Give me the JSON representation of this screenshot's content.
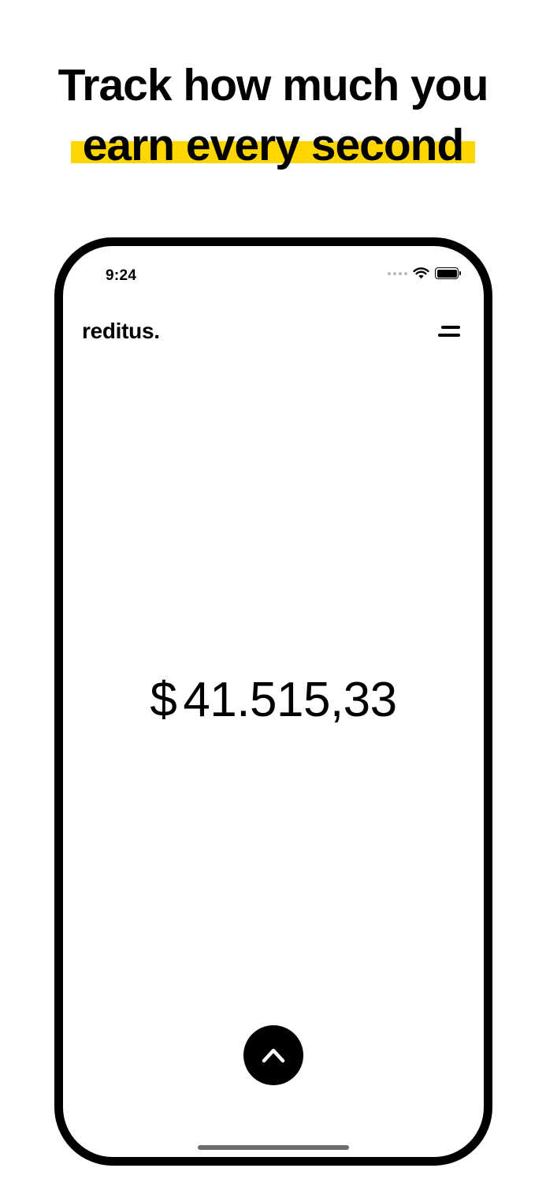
{
  "headline": {
    "line1": "Track how much you",
    "line2": "earn every second",
    "highlight_color": "#ffd600"
  },
  "status_bar": {
    "time": "9:24"
  },
  "app": {
    "logo": "reditus.",
    "menu_icon": "menu-icon"
  },
  "earnings": {
    "currency": "$",
    "amount": "41.515,33"
  },
  "controls": {
    "expand_icon": "chevron-up-icon"
  }
}
